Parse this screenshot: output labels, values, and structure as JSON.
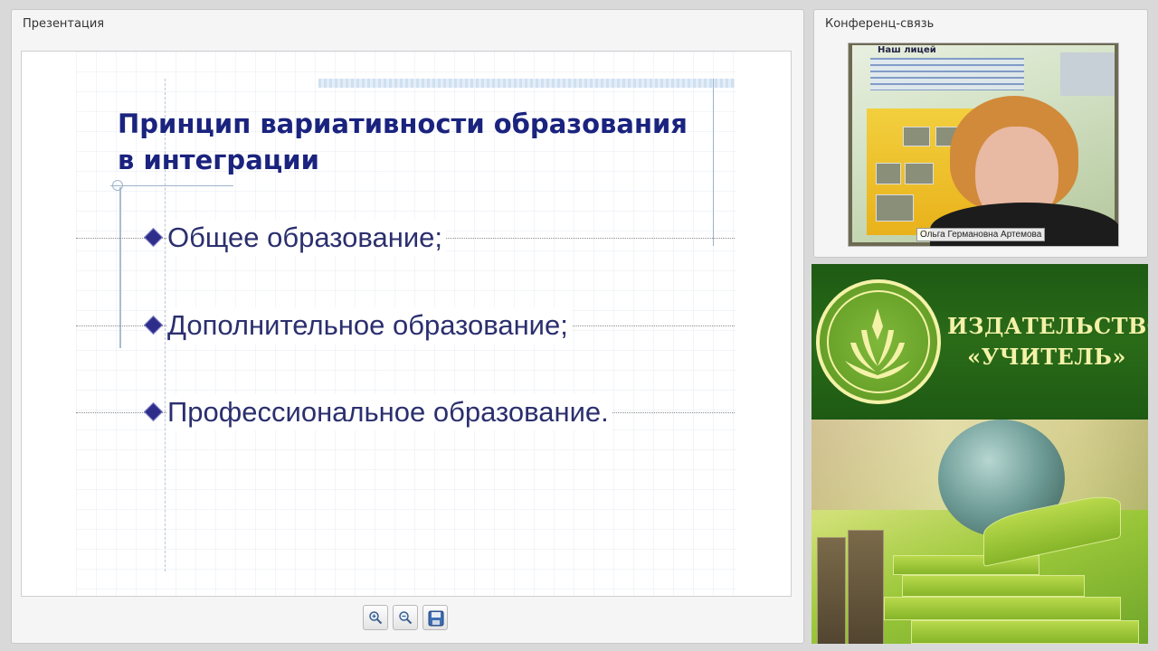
{
  "presentation_panel": {
    "title": "Презентация",
    "slide": {
      "title_line1": "Принцип вариативности образования",
      "title_line2": "в интеграции",
      "bullets": [
        "Общее образование;",
        "Дополнительное образование;",
        "Профессиональное образование."
      ]
    },
    "toolbar": {
      "zoom_in_icon": "zoom-in-icon",
      "zoom_out_icon": "zoom-out-icon",
      "save_icon": "save-icon"
    }
  },
  "conference_panel": {
    "title": "Конференц-связь",
    "participant_name": "Ольга Германовна Артемова",
    "poster_heading": "Наш лицей"
  },
  "ad": {
    "line1": "ИЗДАТЕЛЬСТВО",
    "line2": "«УЧИТЕЛЬ»",
    "colors": {
      "green": "#2a6b18",
      "cream": "#f4f2a8"
    }
  },
  "colors": {
    "slide_title": "#1a237e",
    "slide_text": "#2b2f6e",
    "bullet": "#2e2e8a"
  }
}
